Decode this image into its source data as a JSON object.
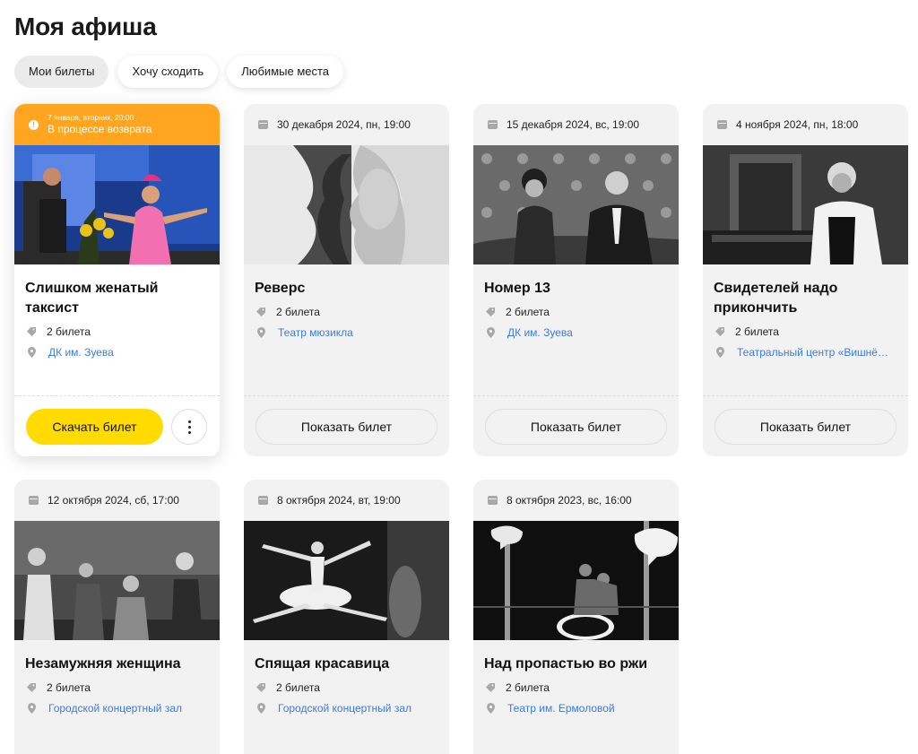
{
  "page": {
    "title": "Моя афиша"
  },
  "tabs": [
    {
      "label": "Мои билеты",
      "active": true
    },
    {
      "label": "Хочу сходить",
      "active": false
    },
    {
      "label": "Любимые места",
      "active": false
    }
  ],
  "colors": {
    "accent_yellow": "#ffdb00",
    "return_orange": "#ffa51f",
    "link_blue": "#3a7be0",
    "card_gray": "#f2f2f2"
  },
  "icons": {
    "date": "calendar-icon",
    "status": "info-icon",
    "tickets": "ticket-tag-icon",
    "venue": "location-pin-icon",
    "more": "more-vertical-icon"
  },
  "events": [
    {
      "id": "e1",
      "status_date": "7 января, вторник, 20:00",
      "status": "В процессе возврата",
      "title": "Слишком женатый таксист",
      "tickets": "2 билета",
      "venue": "ДК им. Зуева",
      "primary_action": "Скачать билет"
    },
    {
      "id": "e2",
      "date": "30 декабря 2024, пн, 19:00",
      "title": "Реверс",
      "tickets": "2 билета",
      "venue": "Театр мюзикла",
      "action": "Показать билет"
    },
    {
      "id": "e3",
      "date": "15 декабря 2024, вс, 19:00",
      "title": "Номер 13",
      "tickets": "2 билета",
      "venue": "ДК им. Зуева",
      "action": "Показать билет"
    },
    {
      "id": "e4",
      "date": "4 ноября 2024, пн, 18:00",
      "title": "Свидетелей надо прикончить",
      "tickets": "2 билета",
      "venue": "Театральный центр «Вишнёвы...",
      "action": "Показать билет"
    },
    {
      "id": "e5",
      "date": "12 октября 2024, сб, 17:00",
      "title": "Незамужняя женщина",
      "tickets": "2 билета",
      "venue": "Городской концертный зал"
    },
    {
      "id": "e6",
      "date": "8 октября 2024, вт, 19:00",
      "title": "Спящая красавица",
      "tickets": "2 билета",
      "venue": "Городской концертный зал"
    },
    {
      "id": "e7",
      "date": "8 октября 2023, вс, 16:00",
      "title": "Над пропастью во ржи",
      "tickets": "2 билета",
      "venue": "Театр им. Ермоловой"
    }
  ]
}
